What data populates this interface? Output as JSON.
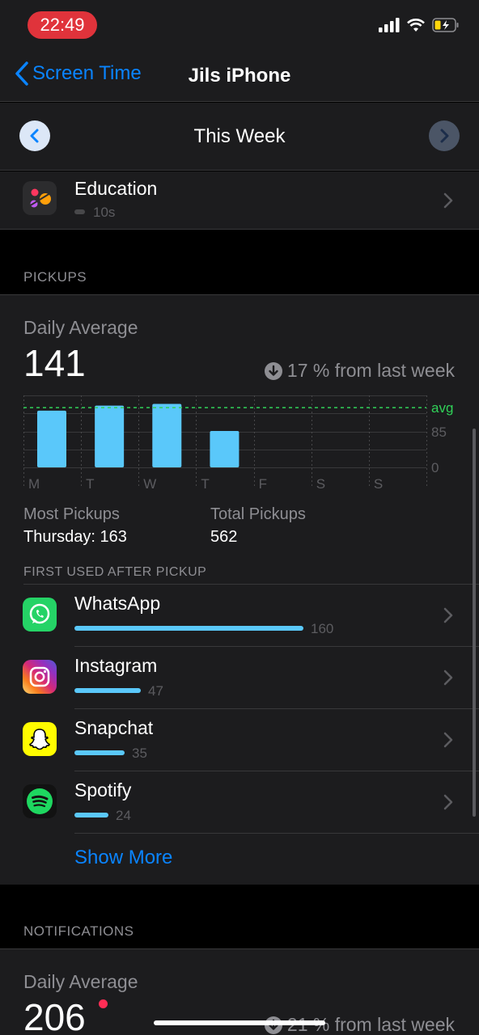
{
  "status": {
    "time": "22:49"
  },
  "nav": {
    "back_label": "Screen Time",
    "title": "Jils iPhone"
  },
  "week": {
    "label": "This Week"
  },
  "education": {
    "name": "Education",
    "time": "10s"
  },
  "pickups": {
    "section_label": "PICKUPS",
    "daily_label": "Daily Average",
    "daily_value": "141",
    "change_text": "17 % from last week",
    "most_label": "Most Pickups",
    "most_value": "Thursday: 163",
    "total_label": "Total Pickups",
    "total_value": "562"
  },
  "chart_data": {
    "type": "bar",
    "categories": [
      "M",
      "T",
      "W",
      "T",
      "F",
      "S",
      "S"
    ],
    "values": [
      134,
      146,
      150,
      86,
      null,
      null,
      null
    ],
    "average": 141,
    "average_label": "avg",
    "ytick_labels": [
      "85",
      "0"
    ],
    "ylim": [
      0,
      170
    ],
    "colors": {
      "bar": "#5ac8fa",
      "avg_line": "#30d158",
      "grid": "#38383a"
    }
  },
  "first_used": {
    "section_label": "FIRST USED AFTER PICKUP",
    "apps": [
      {
        "name": "WhatsApp",
        "count": "160",
        "fraction": 1.0
      },
      {
        "name": "Instagram",
        "count": "47",
        "fraction": 0.29
      },
      {
        "name": "Snapchat",
        "count": "35",
        "fraction": 0.22
      },
      {
        "name": "Spotify",
        "count": "24",
        "fraction": 0.15
      }
    ],
    "show_more": "Show More"
  },
  "notifications": {
    "section_label": "NOTIFICATIONS",
    "daily_label": "Daily Average",
    "daily_value": "206",
    "change_text": "21 % from last week"
  }
}
